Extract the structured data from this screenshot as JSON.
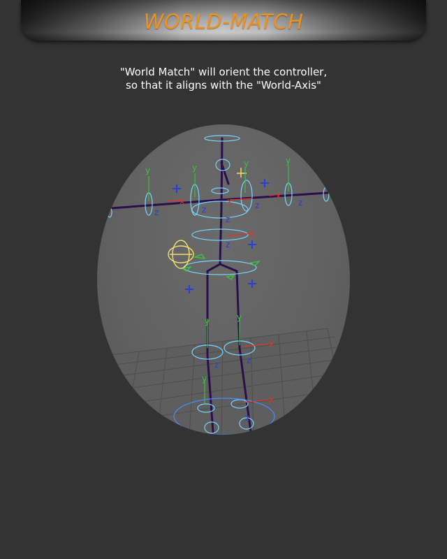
{
  "header": {
    "title": "WORLD-MATCH"
  },
  "description": {
    "line1": "\"World Match\" will orient the controller,",
    "line2": "so that it aligns with the \"World-Axis\""
  },
  "viewport": {
    "axis_labels": {
      "x": "x",
      "y": "y",
      "z": "z"
    }
  },
  "colors": {
    "background": "#333333",
    "title": "#f0911e",
    "viewport": "#626262",
    "controller": "#78d6ff",
    "skeleton": "#2a0f4a",
    "axis_x": "#e0342a",
    "axis_y": "#3fbf3f",
    "axis_z": "#2a3fd6",
    "highlight": "#f2e070"
  }
}
